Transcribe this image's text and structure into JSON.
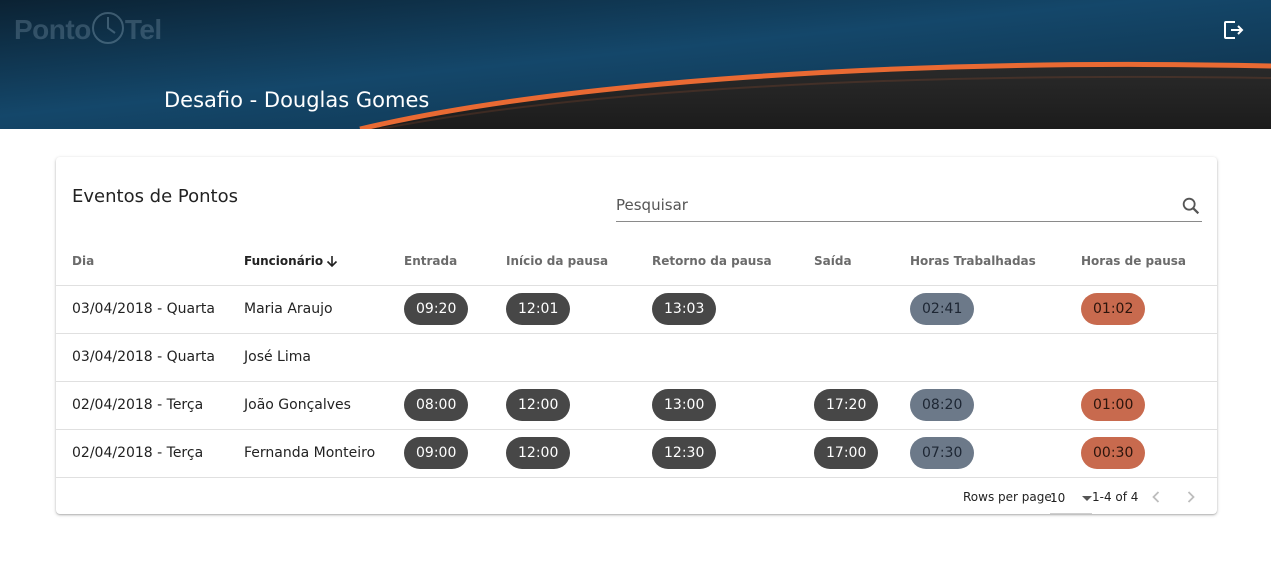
{
  "header": {
    "logo_text_left": "Ponto",
    "logo_text_right": "Tel",
    "title": "Desafio - Douglas Gomes",
    "logout_icon": "logout-icon"
  },
  "card": {
    "title": "Eventos de Pontos",
    "search_placeholder": "Pesquisar",
    "search_value": ""
  },
  "table": {
    "columns": [
      "Dia",
      "Funcionário",
      "Entrada",
      "Início da pausa",
      "Retorno da pausa",
      "Saída",
      "Horas Trabalhadas",
      "Horas de pausa"
    ],
    "sorted_column": "Funcionário",
    "rows": [
      {
        "dia": "03/04/2018 - Quarta",
        "funcionario": "Maria Araujo",
        "entrada": "09:20",
        "inicio_pausa": "12:01",
        "retorno_pausa": "13:03",
        "saida": "",
        "horas_trabalhadas": "02:41",
        "horas_pausa": "01:02"
      },
      {
        "dia": "03/04/2018 - Quarta",
        "funcionario": "José Lima",
        "entrada": "",
        "inicio_pausa": "",
        "retorno_pausa": "",
        "saida": "",
        "horas_trabalhadas": "",
        "horas_pausa": ""
      },
      {
        "dia": "02/04/2018 - Terça",
        "funcionario": "João Gonçalves",
        "entrada": "08:00",
        "inicio_pausa": "12:00",
        "retorno_pausa": "13:00",
        "saida": "17:20",
        "horas_trabalhadas": "08:20",
        "horas_pausa": "01:00"
      },
      {
        "dia": "02/04/2018 - Terça",
        "funcionario": "Fernanda Monteiro",
        "entrada": "09:00",
        "inicio_pausa": "12:00",
        "retorno_pausa": "12:30",
        "saida": "17:00",
        "horas_trabalhadas": "07:30",
        "horas_pausa": "00:30"
      }
    ]
  },
  "pagination": {
    "rows_per_page_label": "Rows per page:",
    "rows_per_page_value": "10",
    "range_label": "1-4 of 4"
  },
  "colors": {
    "header_dark": "#0f3550",
    "header_accent": "#e96a33",
    "chip_dark": "#474747",
    "chip_slate": "#6c7989",
    "chip_orange": "#c86a4e"
  }
}
